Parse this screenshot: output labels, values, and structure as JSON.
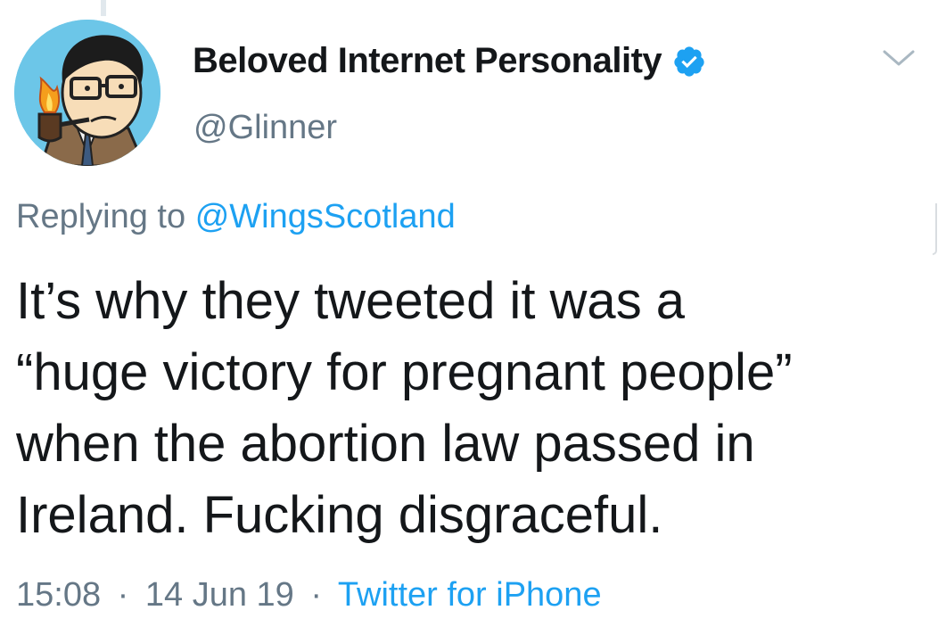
{
  "author": {
    "display_name": "Beloved Internet Personality",
    "handle": "@Glinner",
    "verified": true
  },
  "reply": {
    "prefix": "Replying to",
    "mention": "@WingsScotland"
  },
  "tweet": {
    "text": "It’s why they tweeted it was a\n“huge victory for pregnant people”\nwhen the abortion law passed in\nIreland. Fucking disgraceful."
  },
  "meta": {
    "time": "15:08",
    "date": "14 Jun 19",
    "separator": "·",
    "source": "Twitter for iPhone"
  },
  "icons": {
    "verified": "verified-badge-icon",
    "menu": "chevron-down-icon"
  },
  "colors": {
    "link": "#1da1f2",
    "secondary_text": "#657786",
    "primary_text": "#14171a",
    "avatar_bg": "#6cc6e8"
  }
}
